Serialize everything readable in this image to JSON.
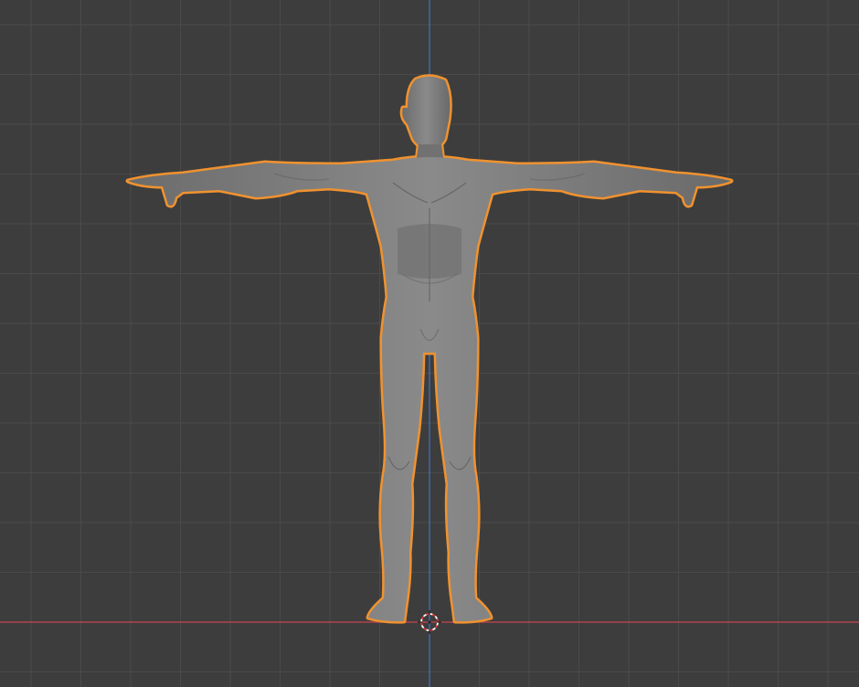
{
  "viewport": {
    "view": "front-orthographic",
    "background_color": "#3d3d3d",
    "grid_color": "#4a4a4a",
    "x_axis_color": "#c64652",
    "z_axis_color": "#3f6fbe",
    "selection_outline_color": "#f0922f",
    "mesh_color": "#7a7a7a",
    "object": {
      "type": "human-figure-mesh",
      "pose": "t-pose",
      "selected": true
    },
    "cursor": {
      "icon": "3d-cursor-icon"
    }
  }
}
